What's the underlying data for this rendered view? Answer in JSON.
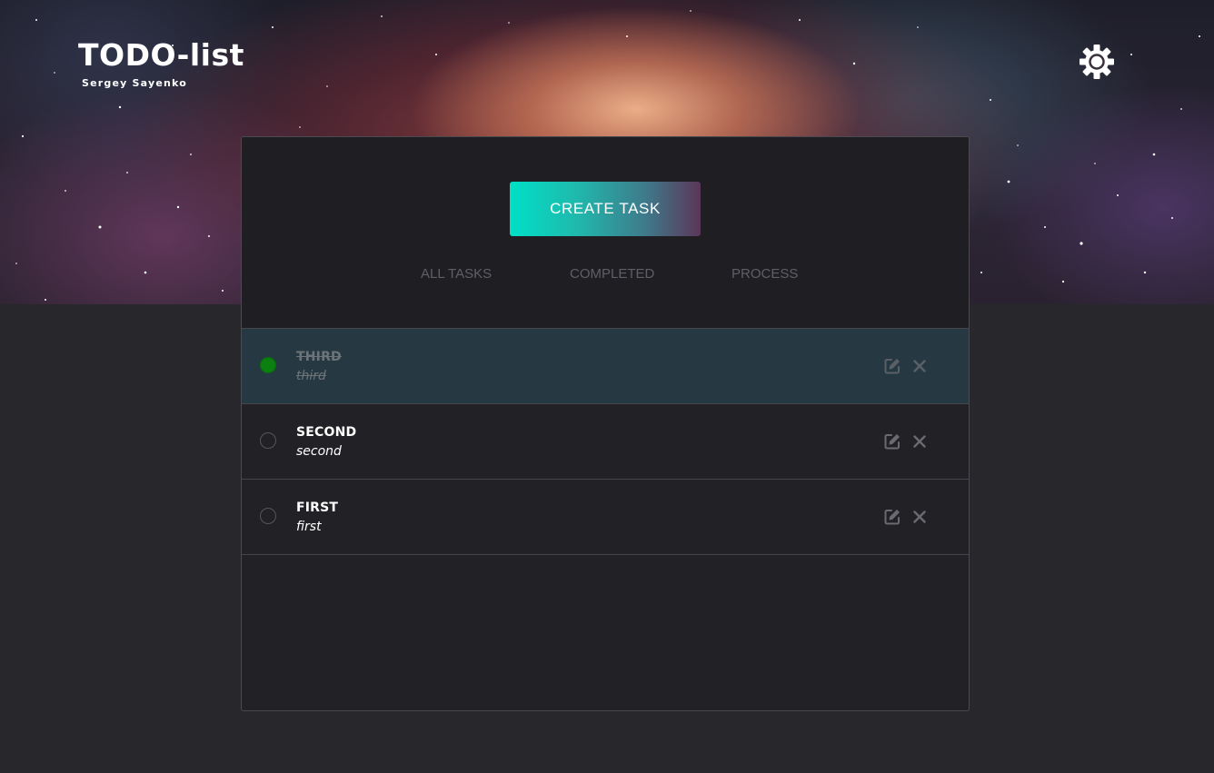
{
  "header": {
    "title": "TODO-list",
    "subtitle": "Sergey Sayenko",
    "theme_toggle_icon": "gear-icon"
  },
  "main": {
    "create_button_label": "CREATE TASK",
    "filters": [
      {
        "label": "ALL TASKS"
      },
      {
        "label": "COMPLETED"
      },
      {
        "label": "PROCESS"
      }
    ],
    "tasks": [
      {
        "title": "THIRD",
        "description": "third",
        "completed": true
      },
      {
        "title": "SECOND",
        "description": "second",
        "completed": false
      },
      {
        "title": "FIRST",
        "description": "first",
        "completed": false
      }
    ],
    "task_actions": {
      "edit_icon": "edit-icon",
      "delete_icon": "close-icon"
    }
  },
  "colors": {
    "page_background": "#28272b",
    "panel_background": "#222226",
    "completed_row": "#263842",
    "completed_check": "#0b7f10",
    "button_gradient_start": "#00e0c6",
    "button_gradient_end": "#5b3659",
    "filter_text": "#5f5f66"
  }
}
